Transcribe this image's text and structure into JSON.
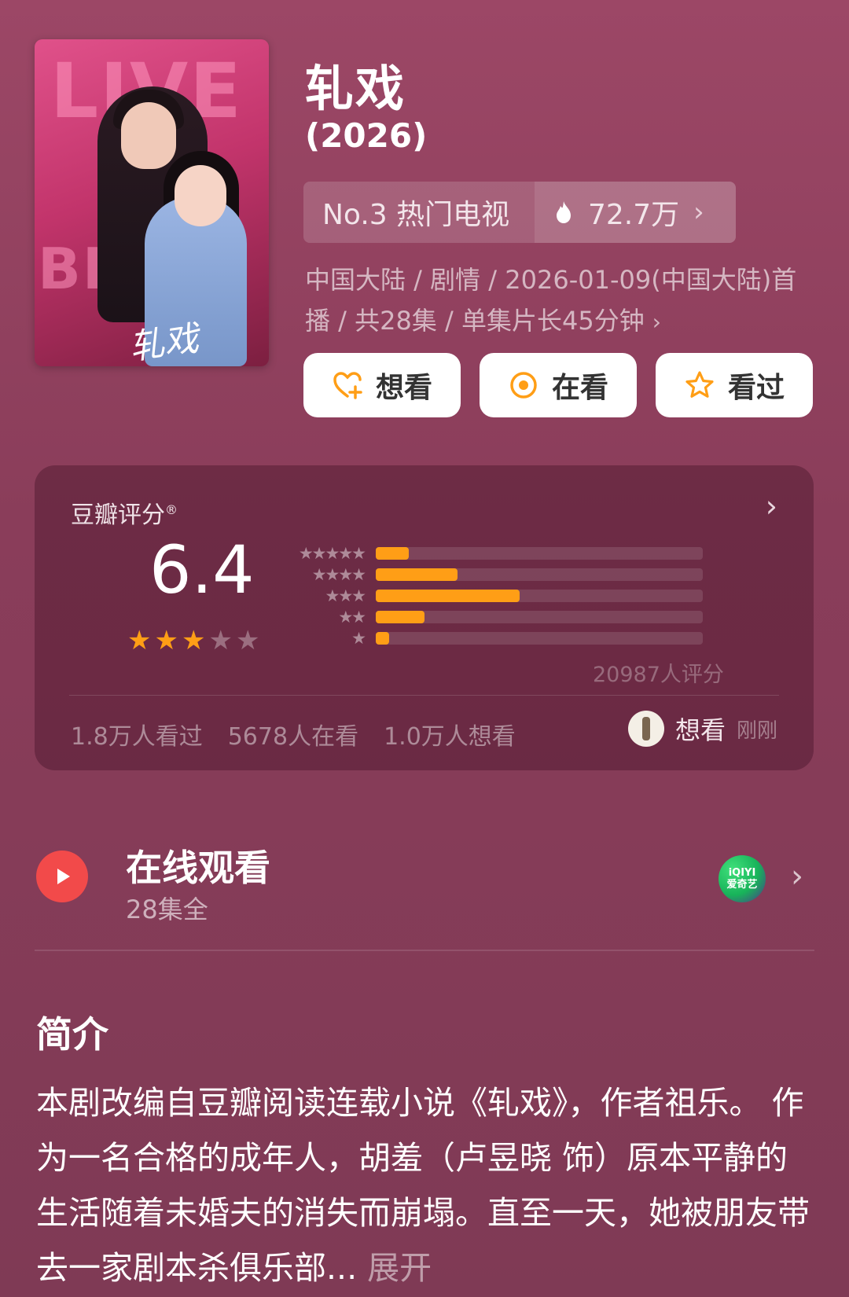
{
  "poster": {
    "signature": "轧戏"
  },
  "header": {
    "title": "轧戏",
    "year": "(2026)"
  },
  "rank": {
    "label": "No.3 热门电视",
    "heat": "72.7万"
  },
  "meta": {
    "line1": "中国大陆 / 剧情 / 2026-01-09(中国大陆)首",
    "line2": "播 / 共28集 / 单集片长45分钟"
  },
  "actions": {
    "want": "想看",
    "watching": "在看",
    "watched": "看过"
  },
  "rating": {
    "label": "豆瓣评分",
    "reg": "®",
    "score": "6.4",
    "stars_filled": 3,
    "stars_total": 5,
    "distribution": [
      {
        "stars": "★★★★★",
        "fraction": 0.1
      },
      {
        "stars": "★★★★",
        "fraction": 0.25
      },
      {
        "stars": "★★★",
        "fraction": 0.44
      },
      {
        "stars": "★★",
        "fraction": 0.15
      },
      {
        "stars": "★",
        "fraction": 0.04
      }
    ],
    "votes": "20987人评分",
    "stats": [
      "1.8万人看过",
      "5678人在看",
      "1.0万人想看"
    ],
    "recent_action": "想看",
    "recent_time": "刚刚"
  },
  "watch": {
    "title": "在线观看",
    "subtitle": "28集全",
    "provider_line1": "iQIYI",
    "provider_line2": "爱奇艺"
  },
  "intro": {
    "title": "简介",
    "text": "本剧改编自豆瓣阅读连载小说《轧戏》，作者祖乐。 作为一名合格的成年人，胡羞（卢昱晓 饰）原本平静的生活随着未婚夫的消失而崩塌。直至一天，她被朋友带去一家剧本杀俱乐部...",
    "expand": "展开"
  },
  "colors": {
    "accent": "#ff9e16",
    "play": "#f24a4a",
    "background": "#8a3d5a"
  }
}
